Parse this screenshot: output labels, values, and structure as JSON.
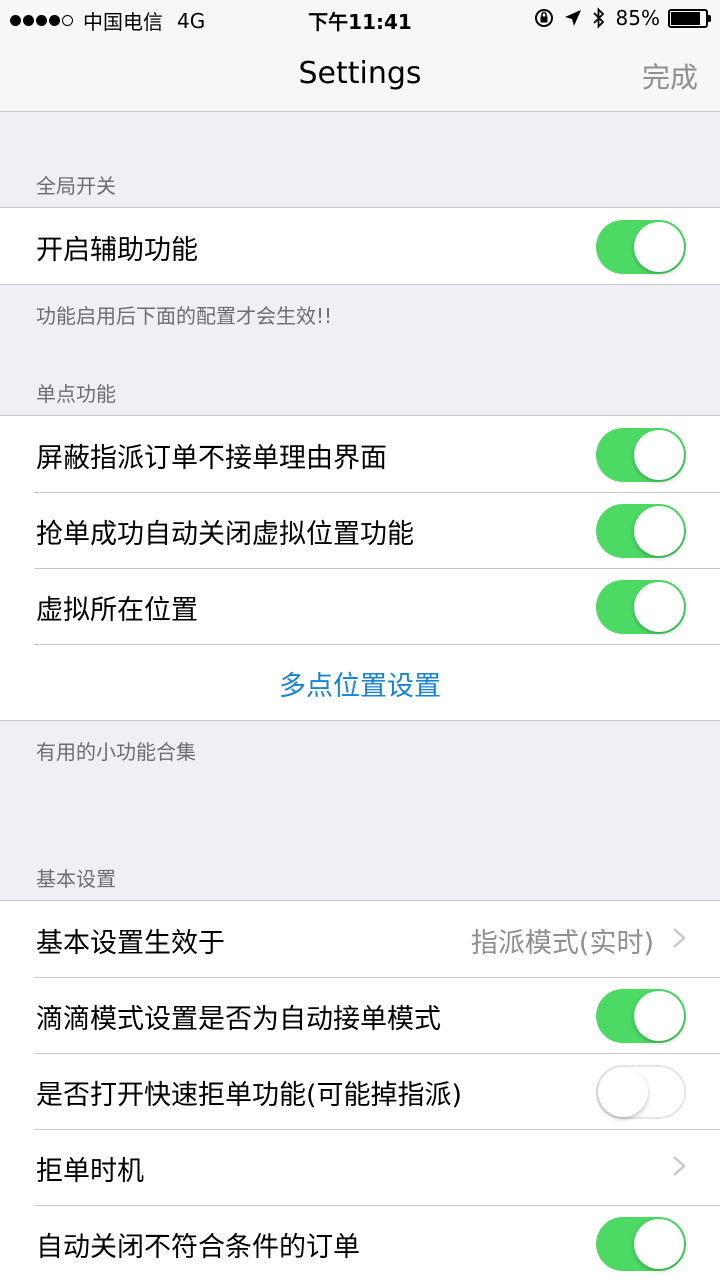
{
  "status": {
    "carrier": "中国电信",
    "network": "4G",
    "time": "下午11:41",
    "battery_pct": "85%",
    "battery_level": 0.85,
    "signal_bars": 4
  },
  "nav": {
    "title": "Settings",
    "done_label": "完成"
  },
  "sections": {
    "global": {
      "header": "全局开关",
      "enable_label": "开启辅助功能",
      "enable_on": true,
      "footer": "功能启用后下面的配置才会生效!!"
    },
    "single": {
      "header": "单点功能",
      "rows": [
        {
          "label": "屏蔽指派订单不接单理由界面",
          "on": true
        },
        {
          "label": "抢单成功自动关闭虚拟位置功能",
          "on": true
        },
        {
          "label": "虚拟所在位置",
          "on": true
        }
      ],
      "multi_location": "多点位置设置"
    },
    "tools": {
      "header": "有用的小功能合集"
    },
    "basic": {
      "header": "基本设置",
      "apply_label": "基本设置生效于",
      "apply_value": "指派模式(实时)",
      "didi_label": "滴滴模式设置是否为自动接单模式",
      "didi_on": true,
      "quick_reject_label": "是否打开快速拒单功能(可能掉指派)",
      "quick_reject_on": false,
      "reject_timing_label": "拒单时机",
      "auto_close_label": "自动关闭不符合条件的订单",
      "auto_close_on": true
    }
  },
  "colors": {
    "toggle_on": "#4cd964",
    "link_blue": "#1a83d5",
    "background": "#efeff4"
  }
}
